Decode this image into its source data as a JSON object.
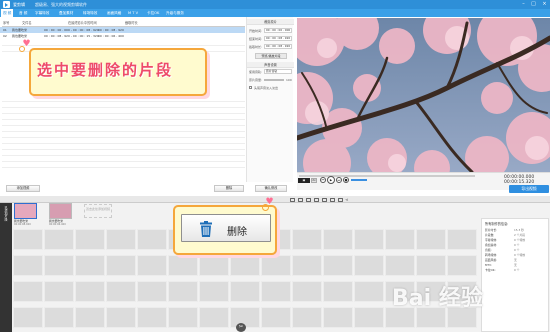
{
  "title_bar": {
    "app_name": "爱剪辑",
    "subtitle": "超级易、强大的视频剪辑软件"
  },
  "menu": {
    "items": [
      "视 频",
      "音 频",
      "字幕特效",
      "叠加素材",
      "转场特效",
      "画面风格",
      "M T V",
      "卡拉OK",
      "升级与服务"
    ],
    "active_index": 0
  },
  "clip_list": {
    "headers": [
      "序号",
      "文件名",
      "在最终影片中的时间",
      "截取时长"
    ],
    "rows": [
      {
        "num": "01",
        "name": "我也要吃米",
        "time": "00 : 00 : 00 . 000 - 00 : 00 : 08 . 920",
        "duration": "00 : 00 : 08 . 920",
        "selected": true
      },
      {
        "num": "02",
        "name": "我也要吃米",
        "time": "00 : 00 : 08 . 920 - 00 : 00 : 15 . 320",
        "duration": "00 : 00 : 06 . 400",
        "selected": false
      }
    ]
  },
  "callout_text": "选中要删除的片段",
  "settings": {
    "section_title": "裁剪原片",
    "start_label": "开始时间:",
    "start_value": "00 : 00 : 00 . 000",
    "end_label": "结束时间:",
    "end_value": "00 : 00 : 08 . 920",
    "trim_label": "截取时长:",
    "trim_value": "00 : 00 : 08 . 920",
    "preview_btn": "预览/播放片段",
    "sound_title": "声音设置",
    "track_label": "使用音轨:",
    "track_value": "原片音轨",
    "volume_label": "原片音量:",
    "volume_value": "100",
    "fade_label": "头尾声音淡入淡出",
    "confirm_btn": "确认修改"
  },
  "list_buttons": {
    "add": "添加视频",
    "delete": "删除"
  },
  "player": {
    "time_current": "00:00:00.000",
    "time_total": "00:00:15.320",
    "speed_badge": "2x",
    "export_label": "导出视频"
  },
  "timeline": {
    "side_label": "已添加片段",
    "clips": [
      {
        "name": "我也要吃米",
        "time": "00:00:08.920"
      },
      {
        "name": "我也要吃米",
        "time": "00:00:06.400"
      }
    ],
    "add_hint": "双击此处添加视频"
  },
  "info_panel": {
    "title": "所有制作的信息:",
    "rows": [
      {
        "label": "影片时长:",
        "value": "15.3 秒"
      },
      {
        "label": "片段数:",
        "value": "2 个片段"
      },
      {
        "label": "字幕特效:",
        "value": "0 个特效"
      },
      {
        "label": "叠加素材:",
        "value": "0 个"
      },
      {
        "label": "音频:",
        "value": "0 个"
      },
      {
        "label": "转场特效:",
        "value": "0 个特效"
      },
      {
        "label": "画面风格:",
        "value": "无"
      },
      {
        "label": "MTV:",
        "value": "无"
      },
      {
        "label": "卡拉OK:",
        "value": "0 个"
      }
    ]
  },
  "delete_popup": {
    "label": "删除"
  },
  "watermark": "Bai 经验",
  "colors": {
    "title_bar": "#2e8fd8",
    "menu_bar": "#3aa0e8",
    "callout_text": "#ee4a6a",
    "callout_border": "#f5a73b",
    "callout_bg": "#fffbcf",
    "selected_row": "#bcd9f5",
    "delete_icon": "#1f6fb8"
  }
}
